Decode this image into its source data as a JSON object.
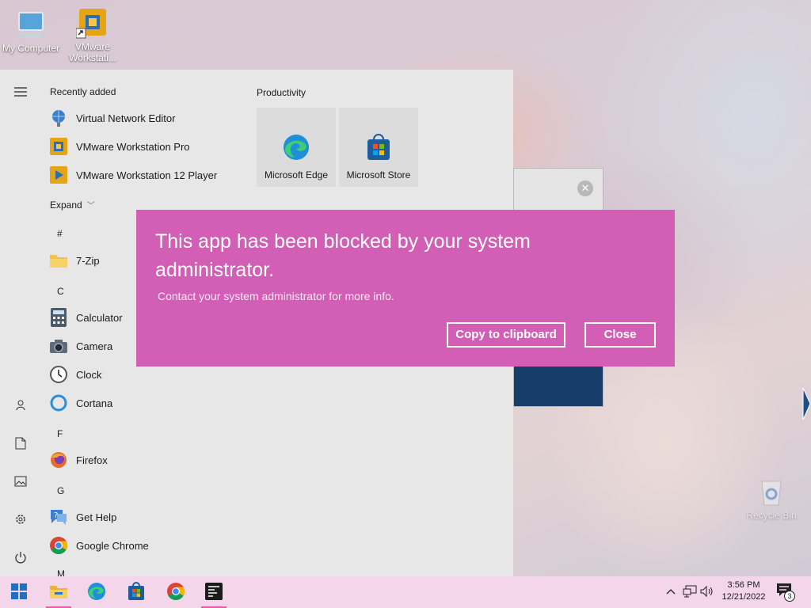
{
  "desktop": {
    "icons": [
      {
        "label": "My Computer",
        "icon": "computer-icon"
      },
      {
        "label": "VMware\nWorkstati...",
        "icon": "vmware-icon"
      },
      {
        "label": "Recycle Bin",
        "icon": "recycle-bin-icon"
      }
    ]
  },
  "start_menu": {
    "recently_added_header": "Recently added",
    "recent": [
      {
        "label": "Virtual Network Editor",
        "icon": "network-globe-icon"
      },
      {
        "label": "VMware Workstation Pro",
        "icon": "vmware-icon"
      },
      {
        "label": "VMware Workstation 12 Player",
        "icon": "vmware-player-icon"
      }
    ],
    "expand_label": "Expand",
    "groups": [
      {
        "letter": "#",
        "apps": [
          {
            "label": "7-Zip",
            "icon": "folder-icon"
          }
        ]
      },
      {
        "letter": "C",
        "apps": [
          {
            "label": "Calculator",
            "icon": "calculator-icon"
          },
          {
            "label": "Camera",
            "icon": "camera-icon"
          },
          {
            "label": "Clock",
            "icon": "clock-icon"
          },
          {
            "label": "Cortana",
            "icon": "cortana-icon"
          }
        ]
      },
      {
        "letter": "F",
        "apps": [
          {
            "label": "Firefox",
            "icon": "firefox-icon"
          }
        ]
      },
      {
        "letter": "G",
        "apps": [
          {
            "label": "Get Help",
            "icon": "help-icon"
          },
          {
            "label": "Google Chrome",
            "icon": "chrome-icon"
          }
        ]
      },
      {
        "letter": "M",
        "apps": []
      }
    ],
    "tiles_header": "Productivity",
    "tiles": [
      {
        "label": "Microsoft Edge",
        "icon": "edge-icon"
      },
      {
        "label": "Microsoft Store",
        "icon": "store-icon"
      }
    ],
    "rail": [
      "hamburger-icon",
      "user-icon",
      "documents-icon",
      "pictures-icon",
      "settings-icon",
      "power-icon"
    ]
  },
  "dialog": {
    "title": "This app has been blocked by your system administrator.",
    "message": "Contact your system administrator for more info.",
    "copy_button": "Copy to clipboard",
    "close_button": "Close",
    "background_color": "#d25fb5"
  },
  "taskbar": {
    "apps": [
      "windows-start-icon",
      "file-explorer-icon",
      "edge-icon",
      "store-icon",
      "chrome-icon",
      "terminal-icon"
    ],
    "time": "3:56 PM",
    "date": "12/21/2022",
    "notification_count": "3"
  }
}
